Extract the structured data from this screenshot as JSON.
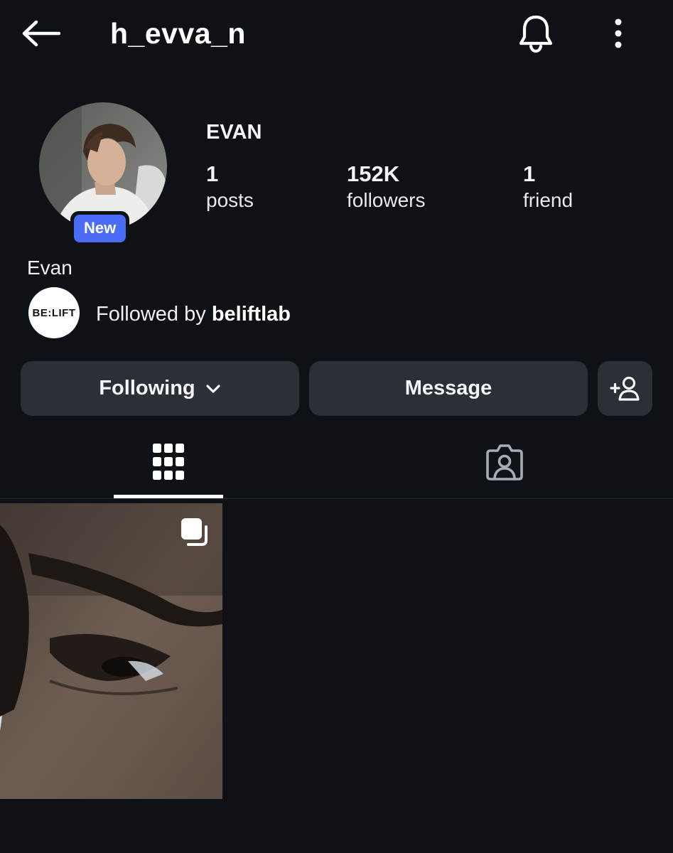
{
  "header": {
    "username": "h_evva_n",
    "back_icon": "arrow-left-icon",
    "bell_icon": "bell-icon",
    "more_icon": "more-vertical-icon"
  },
  "profile": {
    "display_name": "EVAN",
    "badge": "New",
    "bio_name": "Evan",
    "stats": {
      "posts_count": "1",
      "posts_label": "posts",
      "followers_count": "152K",
      "followers_label": "followers",
      "friends_count": "1",
      "friends_label": "friend"
    },
    "followed_by": {
      "prefix": "Followed by ",
      "account": "beliftlab",
      "logo_text": "BE:LIFT"
    }
  },
  "actions": {
    "following_label": "Following",
    "message_label": "Message",
    "add_friend_icon": "add-person-icon"
  },
  "tabs": [
    {
      "name": "posts-grid",
      "icon": "grid-icon",
      "active": true
    },
    {
      "name": "tagged",
      "icon": "tagged-person-icon",
      "active": false
    }
  ],
  "posts": [
    {
      "type": "carousel",
      "icon": "multiple-posts-icon"
    }
  ],
  "colors": {
    "background": "#0e1116",
    "button": "#2b2f36",
    "badge": "#4a6cf7",
    "text": "#ffffff"
  }
}
